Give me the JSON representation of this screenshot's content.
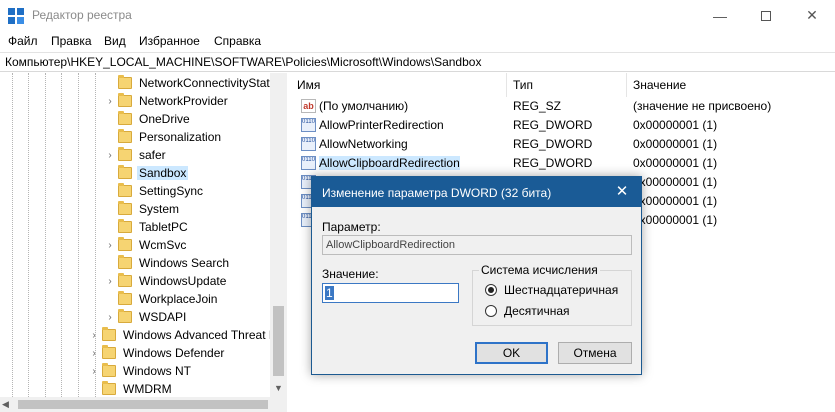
{
  "window": {
    "title": "Редактор реестра"
  },
  "menu": [
    "Файл",
    "Правка",
    "Вид",
    "Избранное",
    "Справка"
  ],
  "address": "Компьютер\\HKEY_LOCAL_MACHINE\\SOFTWARE\\Policies\\Microsoft\\Windows\\Sandbox",
  "tree": {
    "items": [
      {
        "label": "NetworkConnectivityStat",
        "expandable": false,
        "level": 2,
        "selected": false
      },
      {
        "label": "NetworkProvider",
        "expandable": true,
        "level": 2,
        "selected": false
      },
      {
        "label": "OneDrive",
        "expandable": false,
        "level": 2,
        "selected": false
      },
      {
        "label": "Personalization",
        "expandable": false,
        "level": 2,
        "selected": false
      },
      {
        "label": "safer",
        "expandable": true,
        "level": 2,
        "selected": false
      },
      {
        "label": "Sandbox",
        "expandable": false,
        "level": 2,
        "selected": true
      },
      {
        "label": "SettingSync",
        "expandable": false,
        "level": 2,
        "selected": false
      },
      {
        "label": "System",
        "expandable": false,
        "level": 2,
        "selected": false
      },
      {
        "label": "TabletPC",
        "expandable": false,
        "level": 2,
        "selected": false
      },
      {
        "label": "WcmSvc",
        "expandable": true,
        "level": 2,
        "selected": false
      },
      {
        "label": "Windows Search",
        "expandable": false,
        "level": 2,
        "selected": false
      },
      {
        "label": "WindowsUpdate",
        "expandable": true,
        "level": 2,
        "selected": false
      },
      {
        "label": "WorkplaceJoin",
        "expandable": false,
        "level": 2,
        "selected": false
      },
      {
        "label": "WSDAPI",
        "expandable": true,
        "level": 2,
        "selected": false
      },
      {
        "label": "Windows Advanced Threat P",
        "expandable": true,
        "level": 1,
        "selected": false
      },
      {
        "label": "Windows Defender",
        "expandable": true,
        "level": 1,
        "selected": false
      },
      {
        "label": "Windows NT",
        "expandable": true,
        "level": 1,
        "selected": false
      },
      {
        "label": "WMDRM",
        "expandable": false,
        "level": 1,
        "selected": false
      }
    ]
  },
  "columns": {
    "name": "Имя",
    "type": "Тип",
    "value": "Значение"
  },
  "rows": [
    {
      "name": "(По умолчанию)",
      "type": "REG_SZ",
      "value": "(значение не присвоено)",
      "icon": "string-value-icon",
      "selected": false
    },
    {
      "name": "AllowPrinterRedirection",
      "type": "REG_DWORD",
      "value": "0x00000001 (1)",
      "icon": "dword-value-icon",
      "selected": false
    },
    {
      "name": "AllowNetworking",
      "type": "REG_DWORD",
      "value": "0x00000001 (1)",
      "icon": "dword-value-icon",
      "selected": false
    },
    {
      "name": "AllowClipboardRedirection",
      "type": "REG_DWORD",
      "value": "0x00000001 (1)",
      "icon": "dword-value-icon",
      "selected": true
    },
    {
      "name": "",
      "type": "",
      "value": "0x00000001 (1)",
      "icon": "dword-value-icon",
      "selected": false
    },
    {
      "name": "",
      "type": "",
      "value": "0x00000001 (1)",
      "icon": "dword-value-icon",
      "selected": false
    },
    {
      "name": "",
      "type": "",
      "value": "0x00000001 (1)",
      "icon": "dword-value-icon",
      "selected": false
    }
  ],
  "dialog": {
    "title": "Изменение параметра DWORD (32 бита)",
    "param_label": "Параметр:",
    "param_value": "AllowClipboardRedirection",
    "value_label": "Значение:",
    "value": "1",
    "base_group_title": "Система исчисления",
    "base_hex": "Шестнадцатеричная",
    "base_dec": "Десятичная",
    "selected_base": "hex",
    "ok_label": "OK",
    "cancel_label": "Отмена"
  }
}
